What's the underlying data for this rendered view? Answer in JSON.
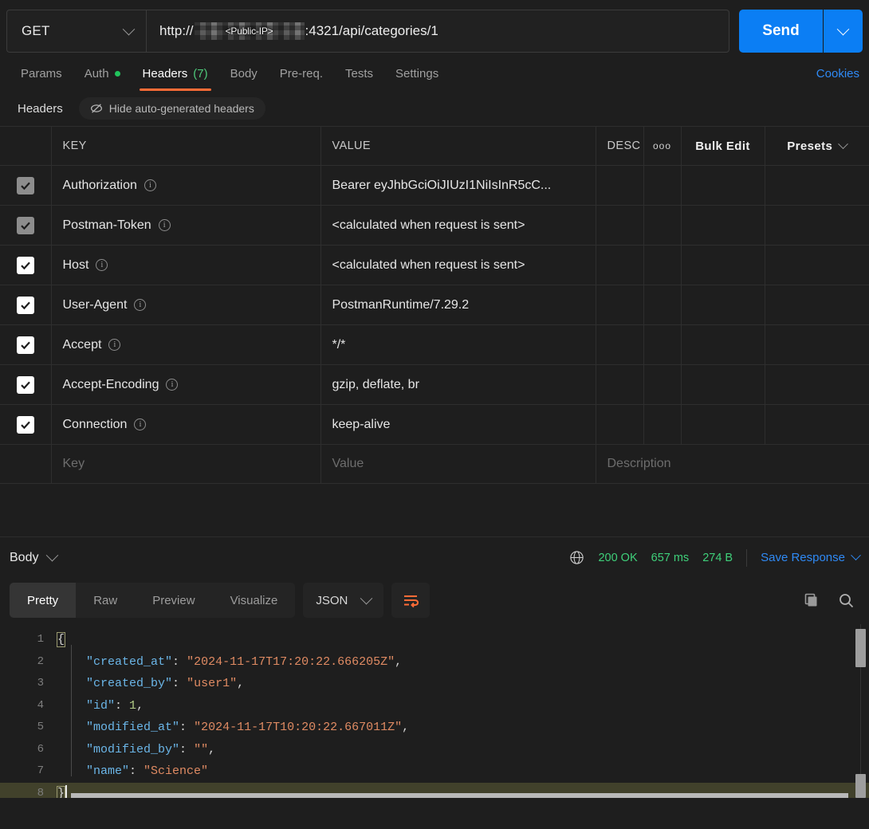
{
  "request": {
    "method": "GET",
    "method_icon": "chevron-down-icon",
    "url_prefix": "http://",
    "url_redacted_label": "<Public-IP>",
    "url_suffix": ":4321/api/categories/1",
    "send_label": "Send",
    "send_caret_icon": "chevron-down-icon"
  },
  "tabs": [
    {
      "label": "Params",
      "active": false,
      "dot": false,
      "count": ""
    },
    {
      "label": "Auth",
      "active": false,
      "dot": true,
      "count": ""
    },
    {
      "label": "Headers",
      "active": true,
      "dot": false,
      "count": "(7)"
    },
    {
      "label": "Body",
      "active": false,
      "dot": false,
      "count": ""
    },
    {
      "label": "Pre-req.",
      "active": false,
      "dot": false,
      "count": ""
    },
    {
      "label": "Tests",
      "active": false,
      "dot": false,
      "count": ""
    },
    {
      "label": "Settings",
      "active": false,
      "dot": false,
      "count": ""
    }
  ],
  "cookies_label": "Cookies",
  "headers_panel": {
    "title": "Headers",
    "hide_button_label": "Hide auto-generated headers",
    "hide_button_icon": "eye-slash-icon",
    "columns": {
      "key": "KEY",
      "value": "VALUE",
      "description": "DESC",
      "more": "⚬⚬⚬",
      "bulk_edit": "Bulk Edit",
      "presets": "Presets"
    },
    "rows": [
      {
        "checked": true,
        "dim": true,
        "key": "Authorization",
        "value": "Bearer eyJhbGciOiJIUzI1NiIsInR5cC..."
      },
      {
        "checked": true,
        "dim": true,
        "key": "Postman-Token",
        "value": "<calculated when request is sent>"
      },
      {
        "checked": true,
        "dim": false,
        "key": "Host",
        "value": "<calculated when request is sent>"
      },
      {
        "checked": true,
        "dim": false,
        "key": "User-Agent",
        "value": "PostmanRuntime/7.29.2"
      },
      {
        "checked": true,
        "dim": false,
        "key": "Accept",
        "value": "*/*"
      },
      {
        "checked": true,
        "dim": false,
        "key": "Accept-Encoding",
        "value": "gzip, deflate, br"
      },
      {
        "checked": true,
        "dim": false,
        "key": "Connection",
        "value": "keep-alive"
      }
    ],
    "empty_row": {
      "key_placeholder": "Key",
      "value_placeholder": "Value",
      "description_placeholder": "Description"
    }
  },
  "response": {
    "body_label": "Body",
    "body_caret_icon": "chevron-down-icon",
    "globe_icon": "globe-icon",
    "status": "200 OK",
    "time": "657 ms",
    "size": "274 B",
    "save_label": "Save Response",
    "save_caret_icon": "chevron-down-icon",
    "view_tabs": [
      {
        "label": "Pretty",
        "active": true
      },
      {
        "label": "Raw",
        "active": false
      },
      {
        "label": "Preview",
        "active": false
      },
      {
        "label": "Visualize",
        "active": false
      }
    ],
    "format": "JSON",
    "format_caret_icon": "chevron-down-icon",
    "wrap_icon": "word-wrap-icon",
    "copy_icon": "copy-icon",
    "search_icon": "search-icon",
    "body_lines": [
      {
        "num": "1",
        "segments": [
          {
            "t": "{",
            "c": "p",
            "box": true
          }
        ],
        "highlight": false
      },
      {
        "num": "2",
        "segments": [
          {
            "t": "    ",
            "c": "p"
          },
          {
            "t": "\"created_at\"",
            "c": "k"
          },
          {
            "t": ": ",
            "c": "p"
          },
          {
            "t": "\"2024-11-17T17:20:22.666205Z\"",
            "c": "s"
          },
          {
            "t": ",",
            "c": "p"
          }
        ],
        "highlight": false
      },
      {
        "num": "3",
        "segments": [
          {
            "t": "    ",
            "c": "p"
          },
          {
            "t": "\"created_by\"",
            "c": "k"
          },
          {
            "t": ": ",
            "c": "p"
          },
          {
            "t": "\"user1\"",
            "c": "s"
          },
          {
            "t": ",",
            "c": "p"
          }
        ],
        "highlight": false
      },
      {
        "num": "4",
        "segments": [
          {
            "t": "    ",
            "c": "p"
          },
          {
            "t": "\"id\"",
            "c": "k"
          },
          {
            "t": ": ",
            "c": "p"
          },
          {
            "t": "1",
            "c": "n"
          },
          {
            "t": ",",
            "c": "p"
          }
        ],
        "highlight": false
      },
      {
        "num": "5",
        "segments": [
          {
            "t": "    ",
            "c": "p"
          },
          {
            "t": "\"modified_at\"",
            "c": "k"
          },
          {
            "t": ": ",
            "c": "p"
          },
          {
            "t": "\"2024-11-17T10:20:22.667011Z\"",
            "c": "s"
          },
          {
            "t": ",",
            "c": "p"
          }
        ],
        "highlight": false
      },
      {
        "num": "6",
        "segments": [
          {
            "t": "    ",
            "c": "p"
          },
          {
            "t": "\"modified_by\"",
            "c": "k"
          },
          {
            "t": ": ",
            "c": "p"
          },
          {
            "t": "\"\"",
            "c": "s"
          },
          {
            "t": ",",
            "c": "p"
          }
        ],
        "highlight": false
      },
      {
        "num": "7",
        "segments": [
          {
            "t": "    ",
            "c": "p"
          },
          {
            "t": "\"name\"",
            "c": "k"
          },
          {
            "t": ": ",
            "c": "p"
          },
          {
            "t": "\"Science\"",
            "c": "s"
          }
        ],
        "highlight": false
      },
      {
        "num": "8",
        "segments": [
          {
            "t": "}",
            "c": "p",
            "box": true
          }
        ],
        "highlight": true,
        "cursor": true
      }
    ]
  },
  "colors": {
    "accent_orange": "#ff6c37",
    "link_blue": "#2f8af5",
    "send_blue": "#0b7ef4",
    "status_green": "#3fd07a",
    "json_key": "#6bb6e8",
    "json_string": "#e08b63",
    "json_number": "#b2cd87"
  }
}
